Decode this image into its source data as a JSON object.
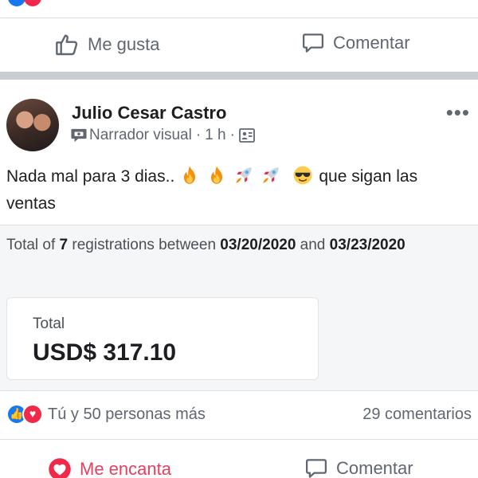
{
  "previous_post": {
    "like_label": "Me gusta",
    "comment_label": "Comentar"
  },
  "post": {
    "author": "Julio Cesar Castro",
    "badge": "Narrador visual",
    "time": "1 h",
    "text_start": "Nada mal para 3 dias..",
    "text_end": "que sigan las ventas",
    "emojis": [
      "fire",
      "fire",
      "rocket",
      "rocket",
      "smiling-face-with-sunglasses"
    ],
    "shared": {
      "reg_prefix": "Total of",
      "reg_count": "7",
      "reg_middle": "registrations between",
      "reg_start_date": "03/20/2020",
      "reg_and": "and",
      "reg_end_date": "03/23/2020",
      "total_label": "Total",
      "total_value": "USD$ 317.10"
    },
    "reactions_text": "Tú y 50 personas más",
    "comments_count": "29 comentarios",
    "love_label": "Me encanta",
    "comment_label": "Comentar"
  },
  "colors": {
    "like_blue": "#1877f2",
    "love_red": "#f0284a",
    "text_muted": "#606770"
  }
}
